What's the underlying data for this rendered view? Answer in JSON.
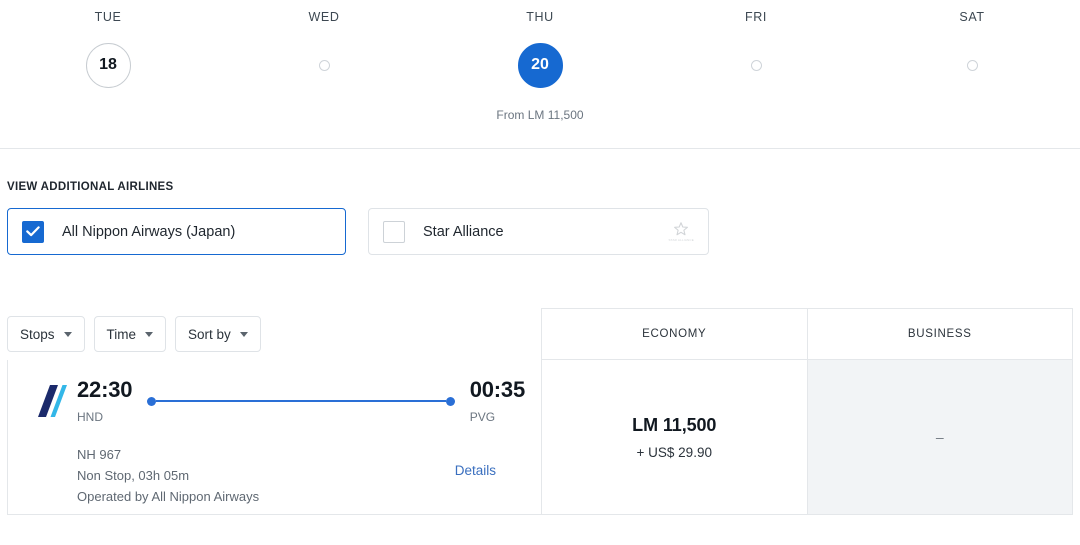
{
  "date_strip": {
    "days": [
      {
        "dow": "TUE",
        "day": "18",
        "state": "outlined",
        "price": ""
      },
      {
        "dow": "WED",
        "day": "",
        "state": "empty",
        "price": ""
      },
      {
        "dow": "THU",
        "day": "20",
        "state": "selected",
        "price": "From LM 11,500"
      },
      {
        "dow": "FRI",
        "day": "",
        "state": "empty",
        "price": ""
      },
      {
        "dow": "SAT",
        "day": "",
        "state": "empty",
        "price": ""
      }
    ]
  },
  "airlines": {
    "section_label": "VIEW ADDITIONAL AIRLINES",
    "options": [
      {
        "label": "All Nippon Airways (Japan)",
        "checked": true
      },
      {
        "label": "Star Alliance",
        "checked": false,
        "logo_caption": "STAR ALLIANCE"
      }
    ]
  },
  "filters": [
    {
      "label": "Stops"
    },
    {
      "label": "Time"
    },
    {
      "label": "Sort by"
    }
  ],
  "fare_columns": [
    {
      "label": "ECONOMY"
    },
    {
      "label": "BUSINESS"
    }
  ],
  "flights": [
    {
      "airline_logo": "ana-logo",
      "depart_time": "22:30",
      "depart_code": "HND",
      "arrive_time": "00:35",
      "arrive_code": "PVG",
      "flight_number": "NH 967",
      "stops_duration": "Non Stop, 03h 05m",
      "operated_by": "Operated by All Nippon Airways",
      "details_label": "Details",
      "fares": [
        {
          "price": "LM 11,500",
          "tax": "+ US$ 29.90",
          "available": true
        },
        {
          "price": "–",
          "tax": "",
          "available": false
        }
      ]
    }
  ],
  "colors": {
    "accent_blue": "#1669d1",
    "route_blue": "#2a6fd6",
    "link_blue": "#3a6fbf",
    "border_grey": "#e4e7ea",
    "business_bg": "#f2f4f6",
    "ana_navy": "#1b2a6b",
    "ana_cyan": "#33b7e8"
  }
}
